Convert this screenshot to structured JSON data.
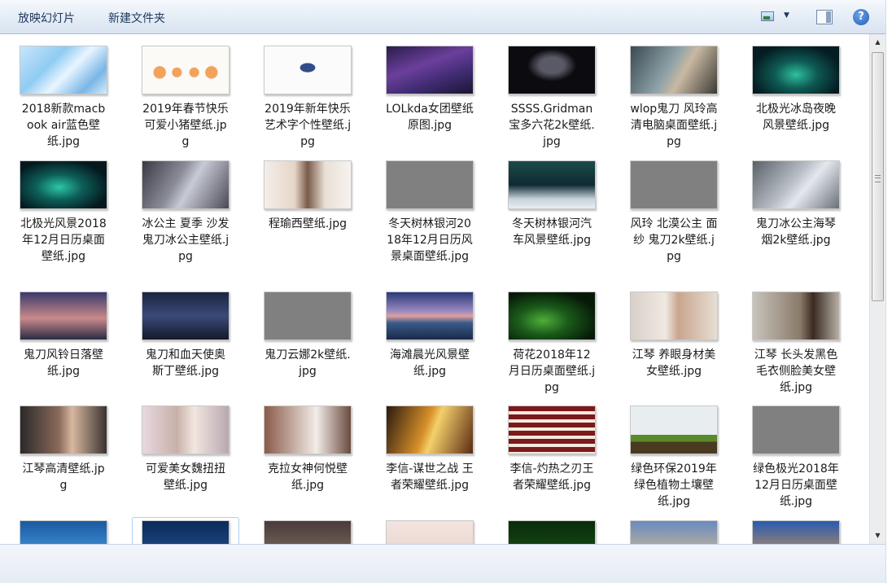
{
  "toolbar": {
    "slideshow_label": "放映幻灯片",
    "new_folder_label": "新建文件夹",
    "help_label": "?"
  },
  "files": [
    {
      "label": "2018新款macbook air蓝色壁纸.jpg",
      "thumb": "linear-gradient(135deg,#c9e6fb 0%,#8fcbf3 35%,#e9f5ff 55%,#79b6e6 80%,#d4ecfb 100%)"
    },
    {
      "label": "2019年春节快乐可爱小猪壁纸.jpg",
      "thumb": "radial-gradient(circle at 20% 55%,#f3a25c 8%,transparent 9%),radial-gradient(circle at 40% 55%,#f3a25c 8%,transparent 9%),radial-gradient(circle at 60% 55%,#f3a25c 8%,transparent 9%),radial-gradient(circle at 80% 55%,#f3a25c 8%,transparent 9%),#fbfaf7"
    },
    {
      "label": "2019年新年快乐艺术字个性壁纸.jpg",
      "thumb": "radial-gradient(ellipse at 50% 45%,#324d8c 0 12%,transparent 13%),#fbfbfb"
    },
    {
      "label": "LOLkda女团壁纸原图.jpg",
      "thumb": "linear-gradient(160deg,#2a1d4a,#6b3f9c 40%,#3c2a6e 70%,#1c1530)"
    },
    {
      "label": "SSSS.Gridman宝多六花2k壁纸.jpg",
      "thumb": "radial-gradient(ellipse at 50% 40%,#5a5a66 0 20%,transparent 40%),#0c0c10"
    },
    {
      "label": "wlop鬼刀 风玲高清电脑桌面壁纸.jpg",
      "thumb": "linear-gradient(120deg,#3a4a52,#8fa3a8 45%,#c9b9a2 60%,#3c3a36)"
    },
    {
      "label": "北极光冰岛夜晚风景壁纸.jpg",
      "thumb": "radial-gradient(ellipse at 50% 60%,#2fbf9c 0,#0e5a54 35%,#051c22 75%)"
    },
    {
      "label": "北极光风景2018年12月日历桌面壁纸.jpg",
      "thumb": "radial-gradient(ellipse at 45% 55%,#2cc6a6 0,#0d5e58 35%,#04181e 75%)"
    },
    {
      "label": "冰公主 夏季 沙发 鬼刀冰公主壁纸.jpg",
      "thumb": "linear-gradient(120deg,#3a3a44,#8a8c98 40%,#c8cad6 55%,#4a4a54)"
    },
    {
      "label": "程瑜西壁纸.jpg",
      "thumb": "linear-gradient(90deg,#f4eee9 0,#e6d5c8 35%,#7a5a48 50%,#e9dfd6 70%,#f7f3ef),linear-gradient(#fff,#fff)"
    },
    {
      "label": "冬天树林银河2018年12月日历风景桌面壁纸.jpg",
      "thumb": "#808080"
    },
    {
      "label": "冬天树林银河汽车风景壁纸.jpg",
      "thumb": "linear-gradient(#1d4a4a,#0e2a33 50%,#c8d2da 80%,#e8eef2)"
    },
    {
      "label": "风玲 北漠公主 面纱 鬼刀2k壁纸.jpg",
      "thumb": "#808080"
    },
    {
      "label": "鬼刀冰公主海琴烟2k壁纸.jpg",
      "thumb": "linear-gradient(130deg,#5a6068,#b8bec6 45%,#e4e8ee 60%,#6a7078)"
    },
    {
      "label": "鬼刀风铃日落壁纸.jpg",
      "thumb": "linear-gradient(#3a3a6a,#c98a8a 55%,#2a2a44)"
    },
    {
      "label": "鬼刀和血天使奥斯丁壁纸.jpg",
      "thumb": "linear-gradient(#1c2440,#3a4a78 50%,#141a2a)"
    },
    {
      "label": "鬼刀云娜2k壁纸.jpg",
      "thumb": "#808080"
    },
    {
      "label": "海滩晨光风景壁纸.jpg",
      "thumb": "linear-gradient(#2a3a7a,#9a8ac0 40%,#e0a0a0 50%,#3a5a8a 65%,#1a2a4a)"
    },
    {
      "label": "荷花2018年12月日历桌面壁纸.jpg",
      "thumb": "radial-gradient(ellipse at 40% 60%,#4fae3a 0,#1a5a1a 35%,#071a07 75%)"
    },
    {
      "label": "江琴 养眼身材美女壁纸.jpg",
      "thumb": "linear-gradient(90deg,#d8d0c8,#efe9e2 40%,#c9a58e 55%,#e7ded4)"
    },
    {
      "label": "江琴 长头发黑色毛衣侧脸美女壁纸.jpg",
      "thumb": "linear-gradient(90deg,#c8c4bc,#8a7a6a 55%,#3a2a22 70%,#b8b0a6)"
    },
    {
      "label": "江琴高清壁纸.jpg",
      "thumb": "linear-gradient(90deg,#2a2a2a,#8a6a5a 45%,#d8b8a0 60%,#3a3230)"
    },
    {
      "label": "可爱美女魏扭扭壁纸.jpg",
      "thumb": "linear-gradient(90deg,#e8d8e0,#c8b0a8 40%,#f2e6e0 60%,#b8a8b0)"
    },
    {
      "label": "克拉女神何悦壁纸.jpg",
      "thumb": "linear-gradient(90deg,#8a5a4a,#d8c8c0 45%,#f2ece8 60%,#6a4a3e)"
    },
    {
      "label": "李信-谋世之战 王者荣耀壁纸.jpg",
      "thumb": "linear-gradient(110deg,#2a1a10,#d8902a 45%,#f4d06a 55%,#5a2a14)"
    },
    {
      "label": "李信-灼热之刃王者荣耀壁纸.jpg",
      "thumb": "repeating-linear-gradient(#7a1a1a 0 6px,#f4e8e0 6px 10px)"
    },
    {
      "label": "绿色环保2019年绿色植物土壤壁纸.jpg",
      "thumb": "linear-gradient(#e8eef0 0 60%,#5a8a2a 60% 75%,#4a3a22 75%)"
    },
    {
      "label": "绿色极光2018年12月日历桌面壁纸.jpg",
      "thumb": "#808080"
    },
    {
      "label": "",
      "thumb": "linear-gradient(#1a5aa0,#3a8ad0 60%,#2a6a3a)"
    },
    {
      "label": "",
      "thumb": "linear-gradient(#0a2a5a,#2a5a9a)"
    },
    {
      "label": "",
      "thumb": "linear-gradient(#4a3a3a,#8a7a6a)"
    },
    {
      "label": "",
      "thumb": "linear-gradient(#f2e4e0,#e8d0c8)"
    },
    {
      "label": "",
      "thumb": "linear-gradient(#0a2a0a,#1a5a1a)"
    },
    {
      "label": "",
      "thumb": "linear-gradient(#6a8ac0,#e8c88a)"
    },
    {
      "label": "",
      "thumb": "linear-gradient(#2a5ab0,#e8a04a)"
    }
  ]
}
